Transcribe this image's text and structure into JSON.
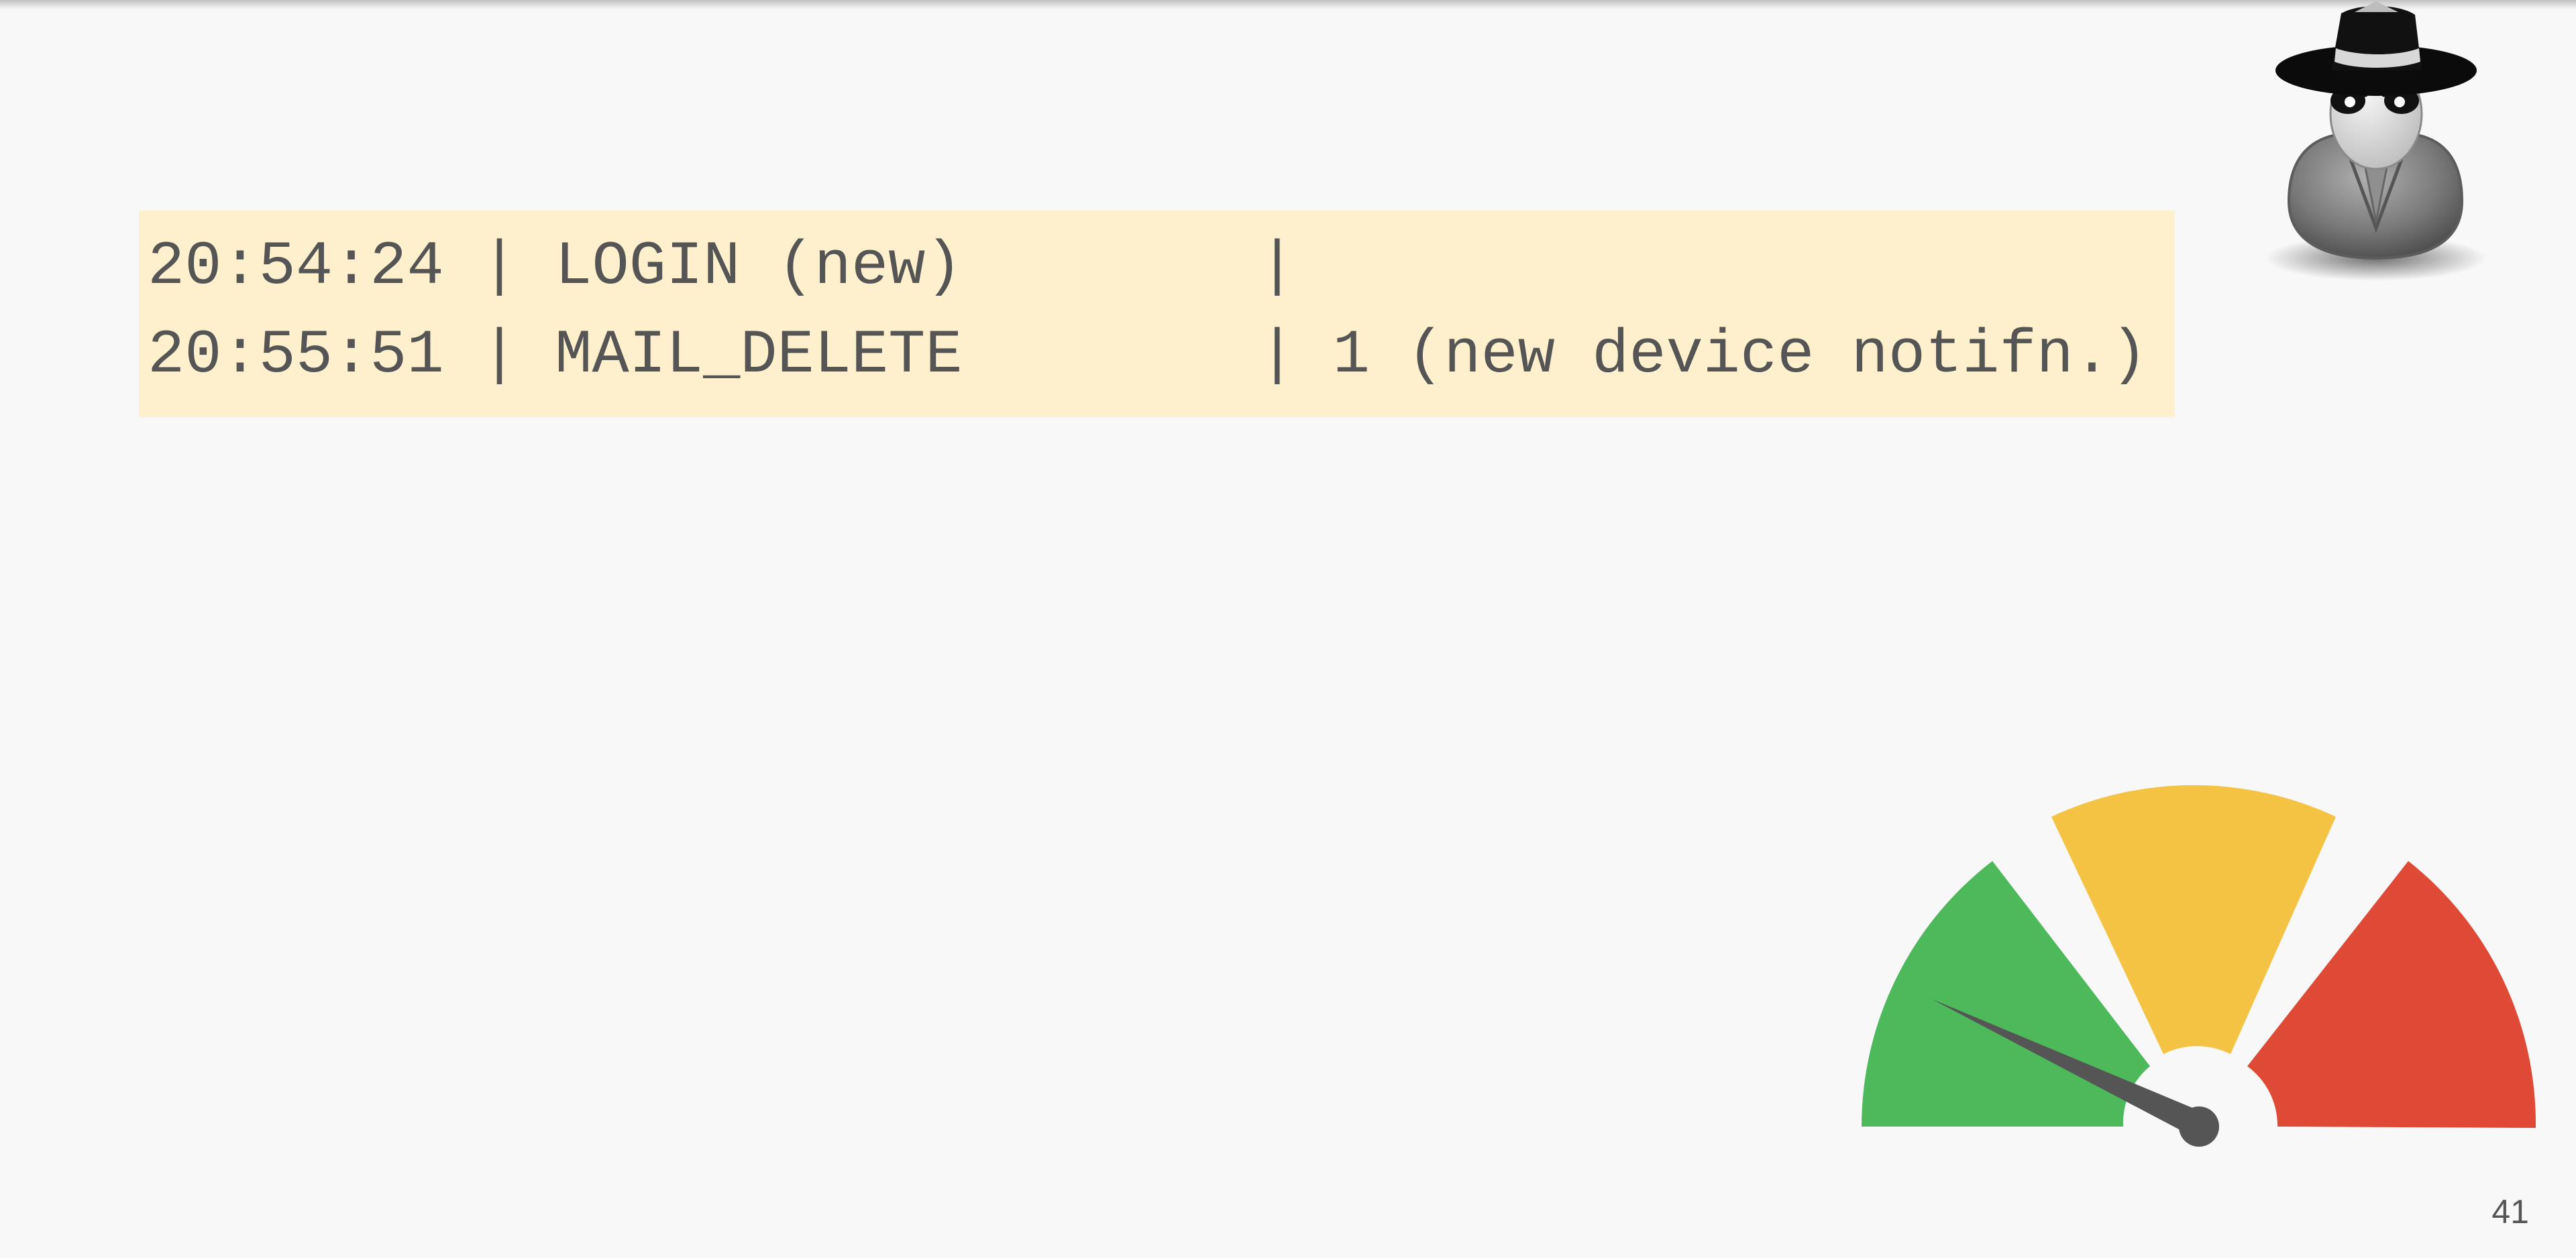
{
  "slide": {
    "log_lines": [
      "20:54:24 | LOGIN (new)        |",
      "20:55:51 | MAIL_DELETE        | 1 (new device notifn.)"
    ],
    "page_number": "41"
  },
  "gauge": {
    "segments": [
      "green",
      "yellow",
      "red"
    ],
    "needle_position": "low",
    "colors": {
      "green": "#4eb95a",
      "yellow": "#f5c343",
      "red": "#de4a36",
      "needle": "#555555"
    }
  },
  "icons": {
    "spy": "spy-incognito-icon",
    "gauge": "risk-gauge-icon"
  },
  "colors": {
    "background": "#f8f8f8",
    "log_highlight": "#fef0cc",
    "text": "#555555"
  }
}
